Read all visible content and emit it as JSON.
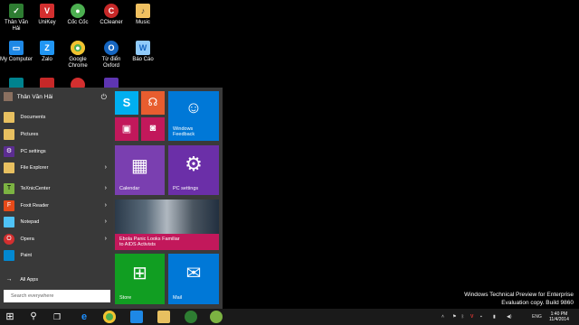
{
  "desktop": {
    "icons": [
      {
        "label": "Thân Văn Hải",
        "icon": "user-folder-icon",
        "color": "#2e7d32"
      },
      {
        "label": "UniKey",
        "icon": "unikey-icon",
        "color": "#d32f2f"
      },
      {
        "label": "Cốc Cốc",
        "icon": "coccoc-icon",
        "color": "#4caf50"
      },
      {
        "label": "CCleaner",
        "icon": "ccleaner-icon",
        "color": "#c62828"
      },
      {
        "label": "Music",
        "icon": "music-folder-icon",
        "color": "#f0c060"
      },
      {
        "label": "My Computer",
        "icon": "computer-icon",
        "color": "#1e88e5"
      },
      {
        "label": "Zalo",
        "icon": "zalo-icon",
        "color": "#2196f3"
      },
      {
        "label": "Google Chrome",
        "icon": "chrome-icon",
        "color": "#4caf50"
      },
      {
        "label": "Từ điển Oxford",
        "icon": "oxford-icon",
        "color": "#1565c0"
      },
      {
        "label": "Báo Cáo",
        "icon": "document-icon",
        "color": "#90caf9"
      }
    ]
  },
  "start_menu": {
    "user_name": "Thân Văn Hải",
    "items": [
      {
        "label": "Documents",
        "icon": "folder-icon",
        "color": "#e8c060",
        "arrow": false
      },
      {
        "label": "Pictures",
        "icon": "folder-icon",
        "color": "#e8c060",
        "arrow": false
      },
      {
        "label": "PC settings",
        "icon": "gear-icon",
        "color": "#5c2d91",
        "arrow": false
      },
      {
        "label": "File Explorer",
        "icon": "folder-icon",
        "color": "#e8c060",
        "arrow": true
      },
      {
        "label": "TeXnicCenter",
        "icon": "texniccenter-icon",
        "color": "#7cb342",
        "arrow": true
      },
      {
        "label": "Foxit Reader",
        "icon": "foxit-icon",
        "color": "#e64a19",
        "arrow": true
      },
      {
        "label": "Notepad",
        "icon": "notepad-icon",
        "color": "#4fc3f7",
        "arrow": true
      },
      {
        "label": "Opera",
        "icon": "opera-icon",
        "color": "#d32f2f",
        "arrow": true
      },
      {
        "label": "Paint",
        "icon": "paint-icon",
        "color": "#0288d1",
        "arrow": false
      }
    ],
    "all_apps": "All Apps",
    "search_placeholder": "Search everywhere"
  },
  "tiles": {
    "skype": {
      "icon": "skype-icon",
      "color": "#00aff0"
    },
    "music": {
      "icon": "headphones-icon",
      "color": "#e85d2f"
    },
    "video": {
      "icon": "video-icon",
      "color": "#c2185b"
    },
    "camera": {
      "icon": "camera-icon",
      "color": "#c2185b"
    },
    "feedback": {
      "label": "Windows Feedback",
      "icon": "feedback-icon",
      "color": "#0078d7"
    },
    "calendar": {
      "label": "Calendar",
      "icon": "calendar-icon",
      "color": "#7a3fb0"
    },
    "pc_settings": {
      "label": "PC settings",
      "icon": "gear-icon",
      "color": "#6b2fa8"
    },
    "news": {
      "headline": "Ebola Panic Looks Familiar to AIDS Activists",
      "color": "#c2185b"
    },
    "store": {
      "label": "Store",
      "icon": "store-icon",
      "color": "#119e22"
    },
    "mail": {
      "label": "Mail",
      "icon": "mail-icon",
      "color": "#0078d7"
    }
  },
  "watermark": {
    "line1": "Windows Technical Preview for Enterprise",
    "line2": "Evaluation copy. Build 9860"
  },
  "taskbar": {
    "language": "ENG",
    "time": "1:40 PM",
    "date": "11/4/2014"
  }
}
